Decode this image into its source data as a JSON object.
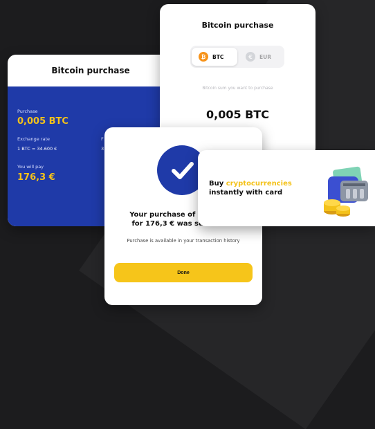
{
  "card_left": {
    "title": "Bitcoin purchase",
    "purchase_label": "Purchase",
    "purchase_value": "0,005 BTC",
    "exchange_label": "Exchange rate",
    "exchange_value": "1 BTC = 34.600 €",
    "fee_label_partial": "F",
    "fee_value_partial": "3",
    "pay_label": "You will pay",
    "pay_value": "176,3 €"
  },
  "card_top": {
    "title": "Bitcoin purchase",
    "tab_btc": "BTC",
    "tab_eur": "EUR",
    "hint": "Bitcoin sum you want to purchase",
    "amount": "0,005 BTC"
  },
  "card_success": {
    "line1": "Your purchase of 0,005 BTC",
    "line2": "for 176,3 € was successful",
    "history": "Purchase is available in your transaction history",
    "done": "Done"
  },
  "promo": {
    "buy": "Buy ",
    "accent": "cryptocurrencies",
    "line2": "instantly with card"
  },
  "colors": {
    "primary_blue": "#1f3aa8",
    "accent_yellow": "#f4c21a",
    "btc_orange": "#f7931a"
  }
}
